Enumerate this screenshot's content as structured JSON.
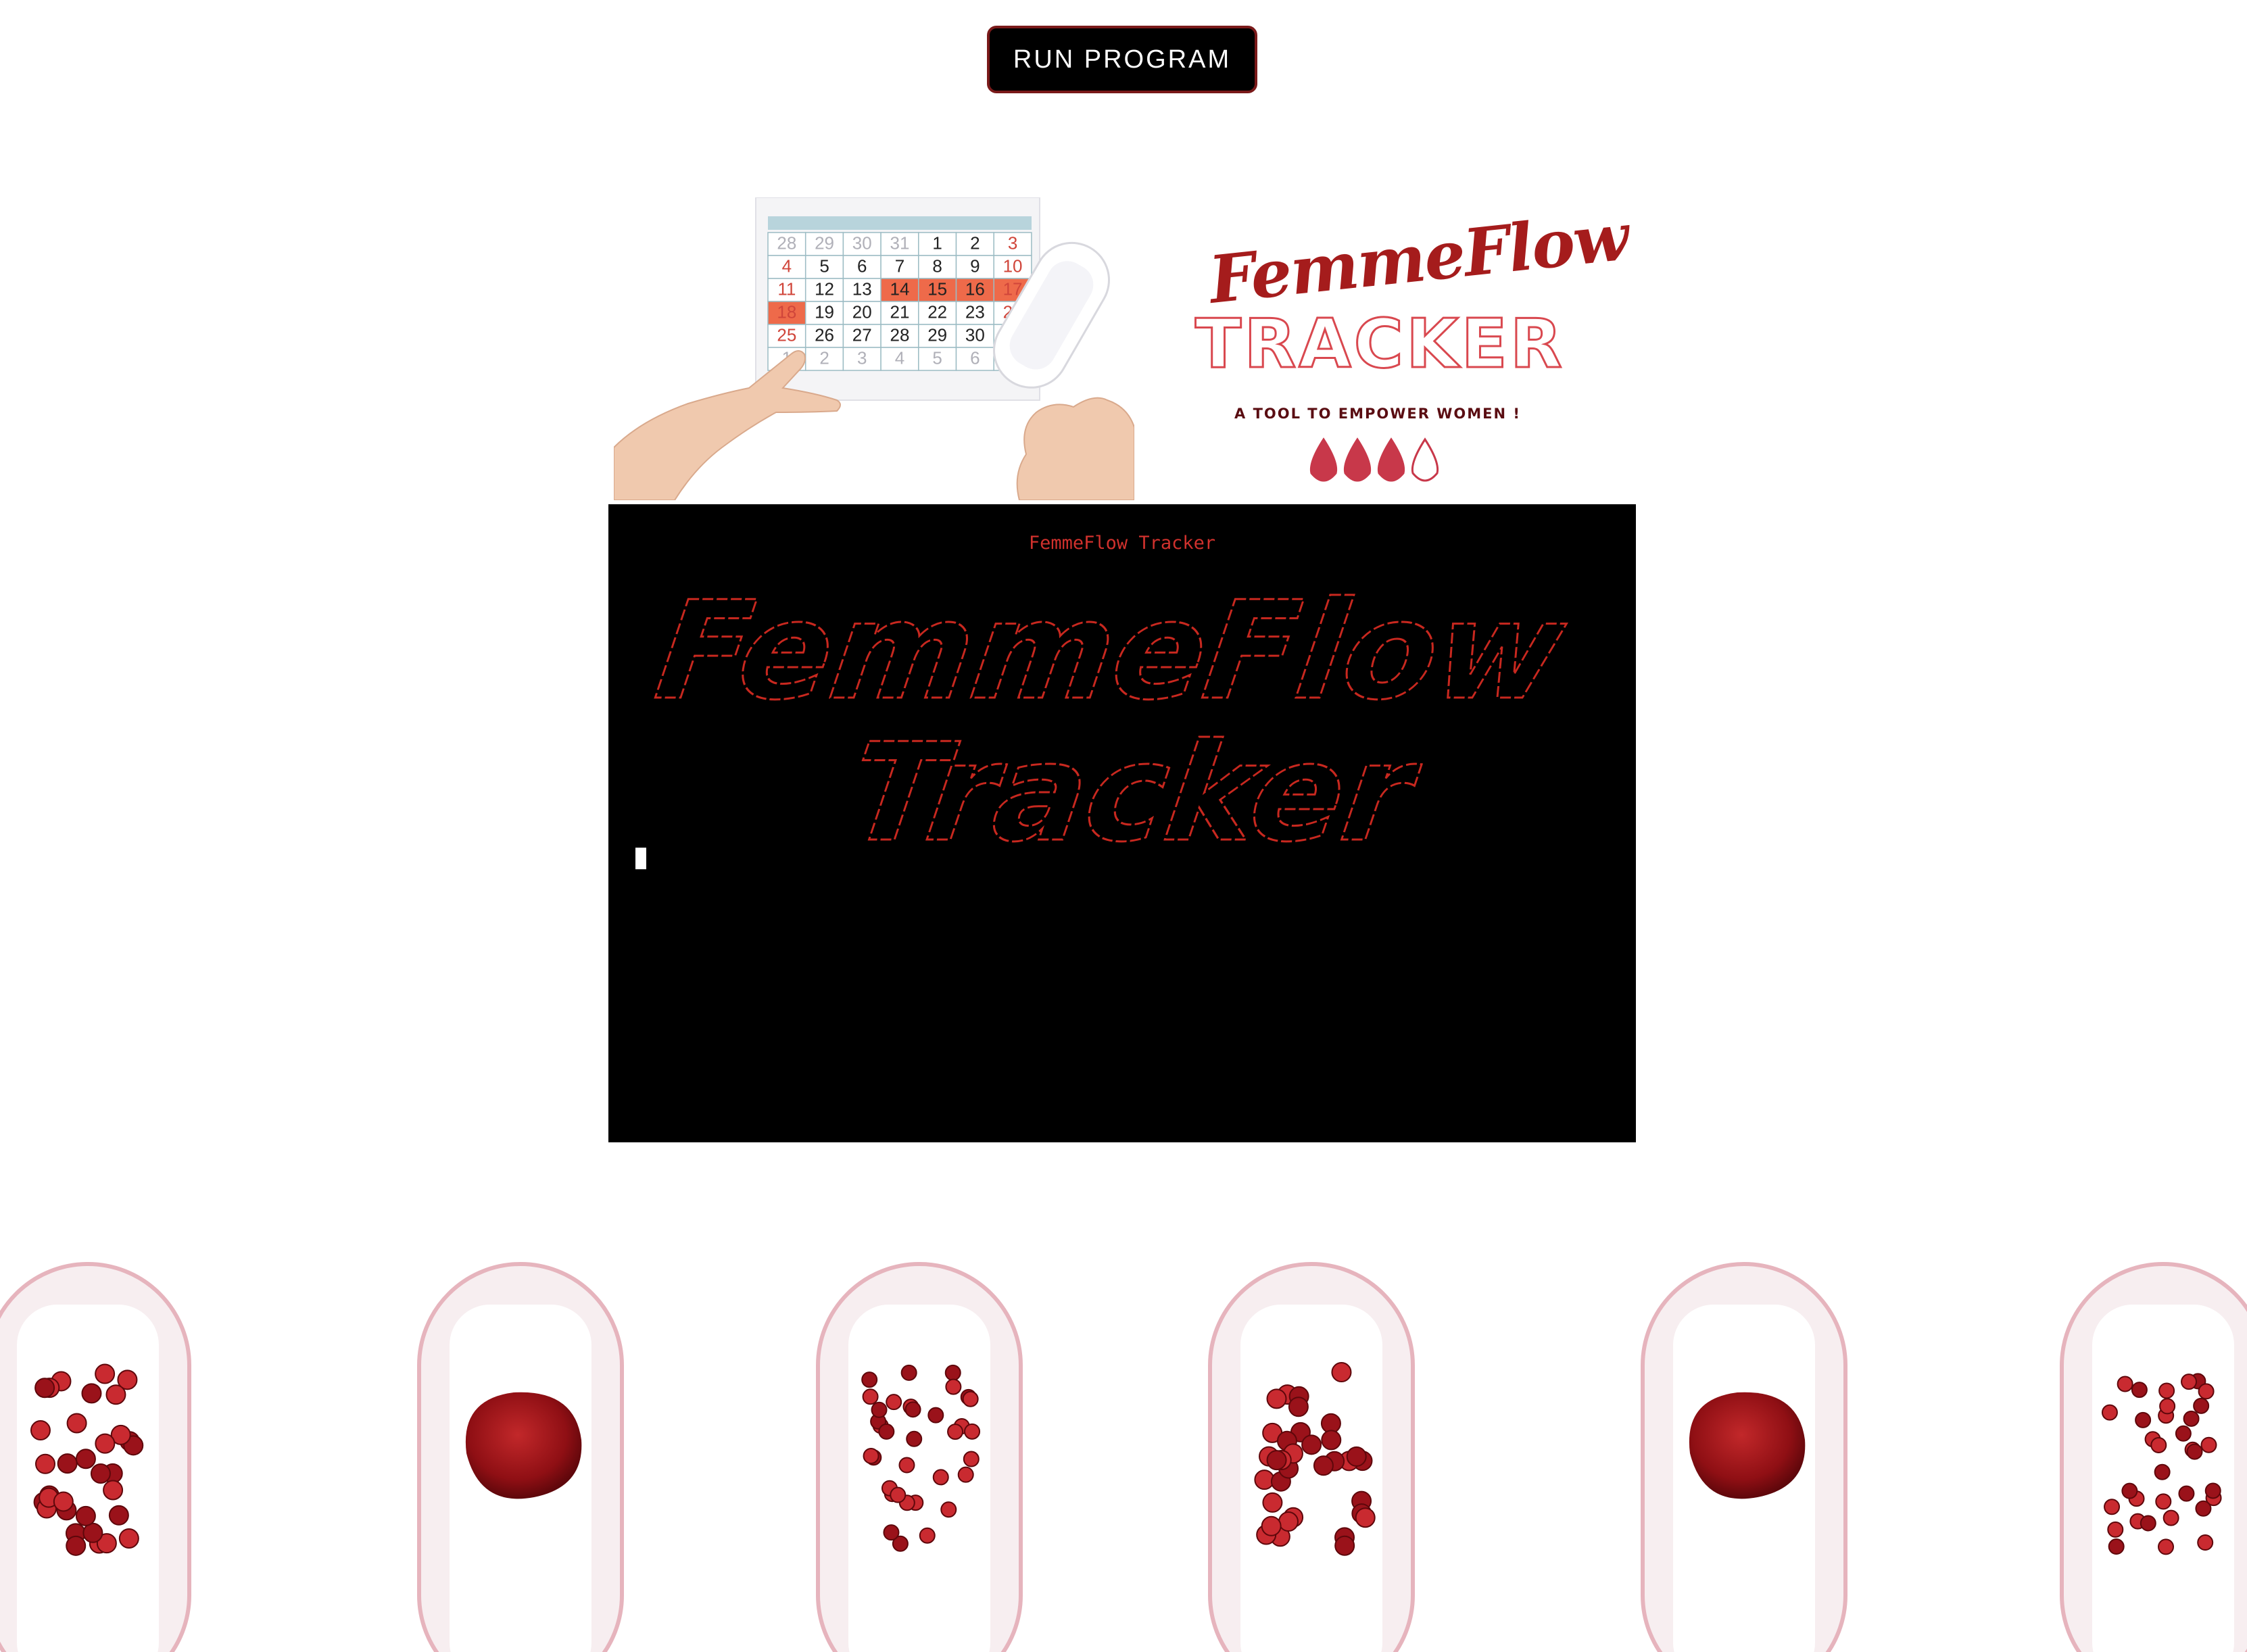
{
  "toolbar": {
    "run_label": "RUN PROGRAM"
  },
  "logo": {
    "title": "FemmeFlow",
    "subtitle": "TRACKER",
    "tagline": "A TOOL TO EMPOWER WOMEN !",
    "drops_filled": 3,
    "drops_total": 4
  },
  "calendar": {
    "rows": [
      [
        "28",
        "29",
        "30",
        "31",
        "1",
        "2",
        "3"
      ],
      [
        "4",
        "5",
        "6",
        "7",
        "8",
        "9",
        "10"
      ],
      [
        "11",
        "12",
        "13",
        "14",
        "15",
        "16",
        "17"
      ],
      [
        "18",
        "19",
        "20",
        "21",
        "22",
        "23",
        "24"
      ],
      [
        "25",
        "26",
        "27",
        "28",
        "29",
        "30",
        ""
      ],
      [
        "1",
        "2",
        "3",
        "4",
        "5",
        "6",
        ""
      ]
    ]
  },
  "terminal": {
    "title": "FemmeFlow Tracker",
    "banner_line1": "FemmeFlow",
    "banner_line2": "Tracker"
  },
  "colors": {
    "accent": "#a51c1c",
    "terminal_text": "#d0312d",
    "button_border": "#7a1a1a",
    "background": "#ffffff"
  },
  "icons": [
    "blood-drop-icon",
    "cursor-block-icon"
  ]
}
